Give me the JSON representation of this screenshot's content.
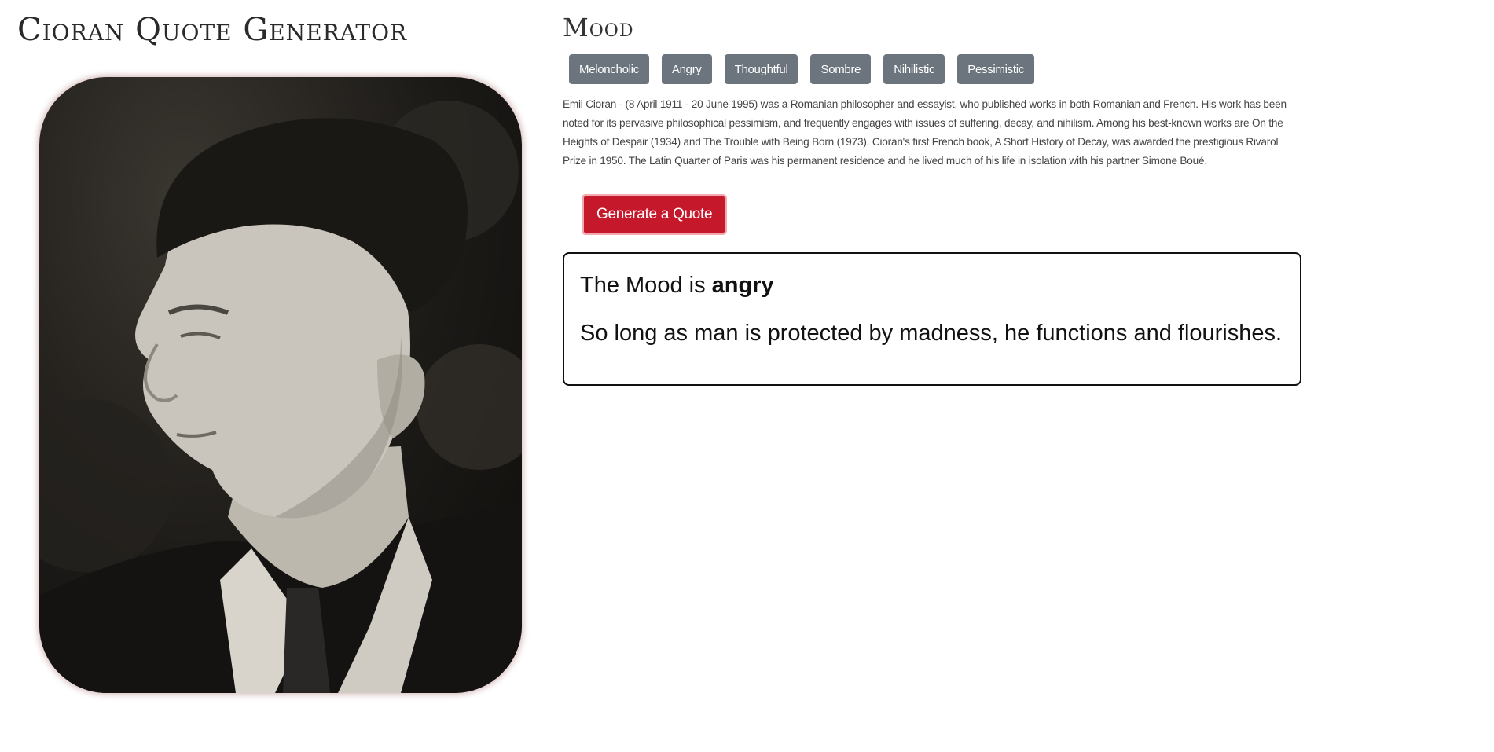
{
  "app": {
    "title": "Cioran Quote Generator"
  },
  "portrait": {
    "alt": "Emil Cioran portrait"
  },
  "mood_section": {
    "heading": "Mood",
    "buttons": [
      {
        "label": "Meloncholic"
      },
      {
        "label": "Angry"
      },
      {
        "label": "Thoughtful"
      },
      {
        "label": "Sombre"
      },
      {
        "label": "Nihilistic"
      },
      {
        "label": "Pessimistic"
      }
    ]
  },
  "bio": {
    "text": "Emil Cioran - (8 April 1911 - 20 June 1995) was a Romanian philosopher and essayist, who published works in both Romanian and French. His work has been noted for its pervasive philosophical pessimism, and frequently engages with issues of suffering, decay, and nihilism. Among his best-known works are On the Heights of Despair (1934) and The Trouble with Being Born (1973). Cioran's first French book, A Short History of Decay, was awarded the prestigious Rivarol Prize in 1950. The Latin Quarter of Paris was his permanent residence and he lived much of his life in isolation with his partner Simone Boué."
  },
  "generate_button": {
    "label": "Generate a Quote"
  },
  "result": {
    "mood_prefix": "The Mood is",
    "mood_value": "angry",
    "quote": "So long as man is protected by madness, he functions and flourishes."
  },
  "colors": {
    "mood_button_bg": "#6c757d",
    "generate_button_bg": "#c5182b",
    "quote_border": "#111111"
  }
}
